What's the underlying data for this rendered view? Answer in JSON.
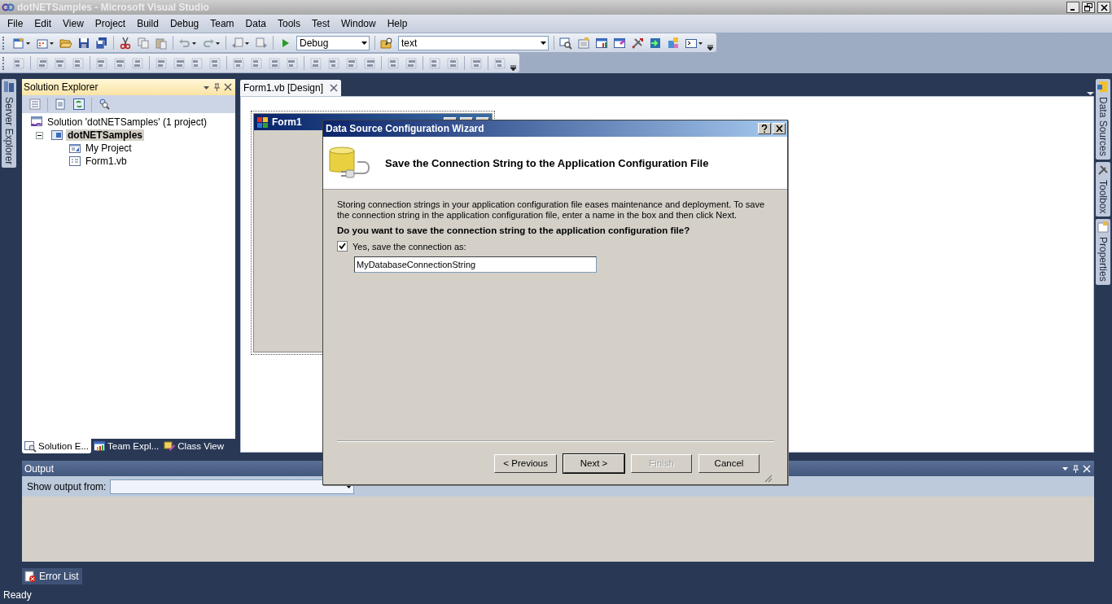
{
  "window": {
    "title": "dotNETSamples - Microsoft Visual Studio"
  },
  "menu": [
    "File",
    "Edit",
    "View",
    "Project",
    "Build",
    "Debug",
    "Team",
    "Data",
    "Tools",
    "Test",
    "Window",
    "Help"
  ],
  "toolbar": {
    "configuration": "Debug",
    "find_box": "text"
  },
  "left_dock_tabs": [
    "Server Explorer"
  ],
  "right_dock_tabs": [
    "Data Sources",
    "Toolbox",
    "Properties"
  ],
  "solution_explorer": {
    "title": "Solution Explorer",
    "tree": [
      {
        "label": "Solution 'dotNETSamples' (1 project)",
        "kind": "solution",
        "selected": false,
        "bold": false,
        "children": [
          {
            "label": "dotNETSamples",
            "kind": "project",
            "selected": true,
            "bold": true,
            "expanded": true,
            "children": [
              {
                "label": "My Project",
                "kind": "properties",
                "selected": false,
                "bold": false
              },
              {
                "label": "Form1.vb",
                "kind": "form",
                "selected": false,
                "bold": false
              }
            ]
          }
        ]
      }
    ],
    "tabs": [
      {
        "label": "Solution E...",
        "kind": "solution",
        "selected": true
      },
      {
        "label": "Team Expl...",
        "kind": "team",
        "selected": false
      },
      {
        "label": "Class View",
        "kind": "class",
        "selected": false
      }
    ]
  },
  "document_tabs": [
    {
      "label": "Form1.vb [Design]",
      "selected": true
    }
  ],
  "designer": {
    "form_title": "Form1"
  },
  "dialog": {
    "title": "Data Source Configuration Wizard",
    "heading": "Save the Connection String to the Application Configuration File",
    "description": "Storing connection strings in your application configuration file eases maintenance and deployment. To save the connection string in the application configuration file, enter a name in the box and then click Next.",
    "question": "Do you want to save the connection string to the application configuration file?",
    "save_checkbox": {
      "label": "Yes, save the connection as:",
      "checked": true
    },
    "connection_name": {
      "value": "MyDatabaseConnectionString"
    },
    "buttons": [
      {
        "label": "< Previous",
        "default": false,
        "disabled": false
      },
      {
        "label": "Next >",
        "default": true,
        "disabled": false
      },
      {
        "label": "Finish",
        "default": false,
        "disabled": true
      },
      {
        "label": "Cancel",
        "default": false,
        "disabled": false
      }
    ]
  },
  "output": {
    "title": "Output",
    "source_label": "Show output from:"
  },
  "bottom_tabs": [
    "Error List"
  ],
  "status_bar": {
    "text": "Ready"
  }
}
